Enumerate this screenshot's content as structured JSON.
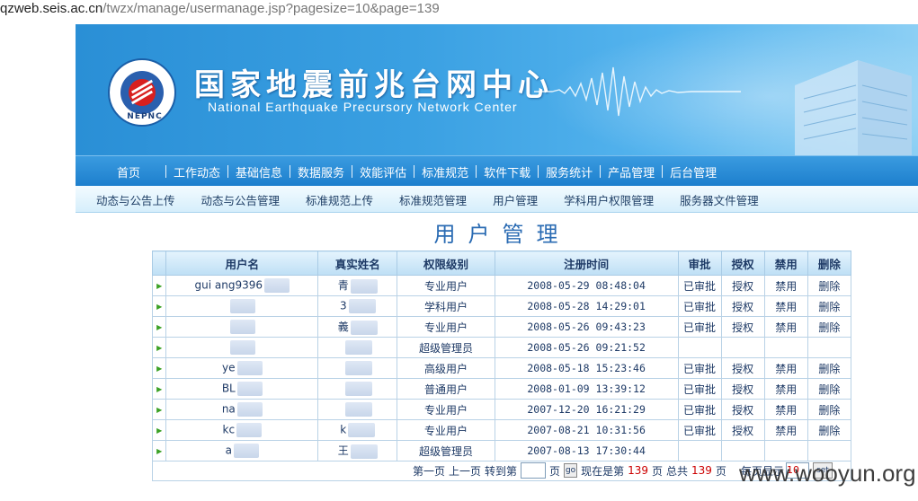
{
  "browser": {
    "url_host": "qzweb.seis.ac.cn",
    "url_path": "/twzx/manage/usermanage.jsp?pagesize=10&page=139"
  },
  "banner": {
    "cn_title": "国家地震前兆台网中心",
    "en_title": "National Earthquake Precursory Network Center",
    "logo_text": "NEPNC"
  },
  "main_nav": [
    "首页",
    "工作动态",
    "基础信息",
    "数据服务",
    "效能评估",
    "标准规范",
    "软件下载",
    "服务统计",
    "产品管理",
    "后台管理"
  ],
  "sub_nav": [
    "动态与公告上传",
    "动态与公告管理",
    "标准规范上传",
    "标准规范管理",
    "用户管理",
    "学科用户权限管理",
    "服务器文件管理"
  ],
  "page_title": "用户管理",
  "table": {
    "headers": [
      "用户名",
      "真实姓名",
      "权限级别",
      "注册时间",
      "审批",
      "授权",
      "禁用",
      "删除"
    ],
    "rows": [
      {
        "user": "gui     ang9396",
        "real": "   青",
        "level": "专业用户",
        "time": "2008-05-29 08:48:04",
        "approve": "已审批",
        "auth": "授权",
        "ban": "禁用",
        "del": "删除"
      },
      {
        "user": "",
        "real": "   3",
        "level": "学科用户",
        "time": "2008-05-28 14:29:01",
        "approve": "已审批",
        "auth": "授权",
        "ban": "禁用",
        "del": "删除"
      },
      {
        "user": "",
        "real": "   義",
        "level": "专业用户",
        "time": "2008-05-26 09:43:23",
        "approve": "已审批",
        "auth": "授权",
        "ban": "禁用",
        "del": "删除"
      },
      {
        "user": "",
        "real": "",
        "level": "超级管理员",
        "time": "2008-05-26 09:21:52",
        "approve": "",
        "auth": "",
        "ban": "",
        "del": ""
      },
      {
        "user": "ye",
        "real": "",
        "level": "高级用户",
        "time": "2008-05-18 15:23:46",
        "approve": "已审批",
        "auth": "授权",
        "ban": "禁用",
        "del": "删除"
      },
      {
        "user": "BL",
        "real": "",
        "level": "普通用户",
        "time": "2008-01-09 13:39:12",
        "approve": "已审批",
        "auth": "授权",
        "ban": "禁用",
        "del": "删除"
      },
      {
        "user": "na",
        "real": "",
        "level": "专业用户",
        "time": "2007-12-20 16:21:29",
        "approve": "已审批",
        "auth": "授权",
        "ban": "禁用",
        "del": "删除"
      },
      {
        "user": "kc",
        "real": "k",
        "level": "专业用户",
        "time": "2007-08-21 10:31:56",
        "approve": "已审批",
        "auth": "授权",
        "ban": "禁用",
        "del": "删除"
      },
      {
        "user": "a",
        "real": "王",
        "level": "超级管理员",
        "time": "2007-08-13 17:30:44",
        "approve": "",
        "auth": "",
        "ban": "",
        "del": ""
      }
    ]
  },
  "pager": {
    "first": "第一页",
    "prev": "上一页",
    "goto_prefix": "转到第",
    "goto_suffix": "页",
    "go_button": "go",
    "current_prefix": "现在是第",
    "current_page": "139",
    "current_suffix": "页",
    "total_prefix": "总共",
    "total_pages": "139",
    "total_suffix": "页",
    "per_page_label": "每页显示",
    "per_page_value": "10",
    "set_button": "set"
  },
  "watermark": "www.wooyun.org",
  "colors": {
    "banner_blue": "#2a8fd6",
    "nav_blue": "#1d7fcd",
    "title_blue": "#2a6bb3",
    "pager_red": "#cc0000",
    "arrow_green": "#3aa024"
  }
}
